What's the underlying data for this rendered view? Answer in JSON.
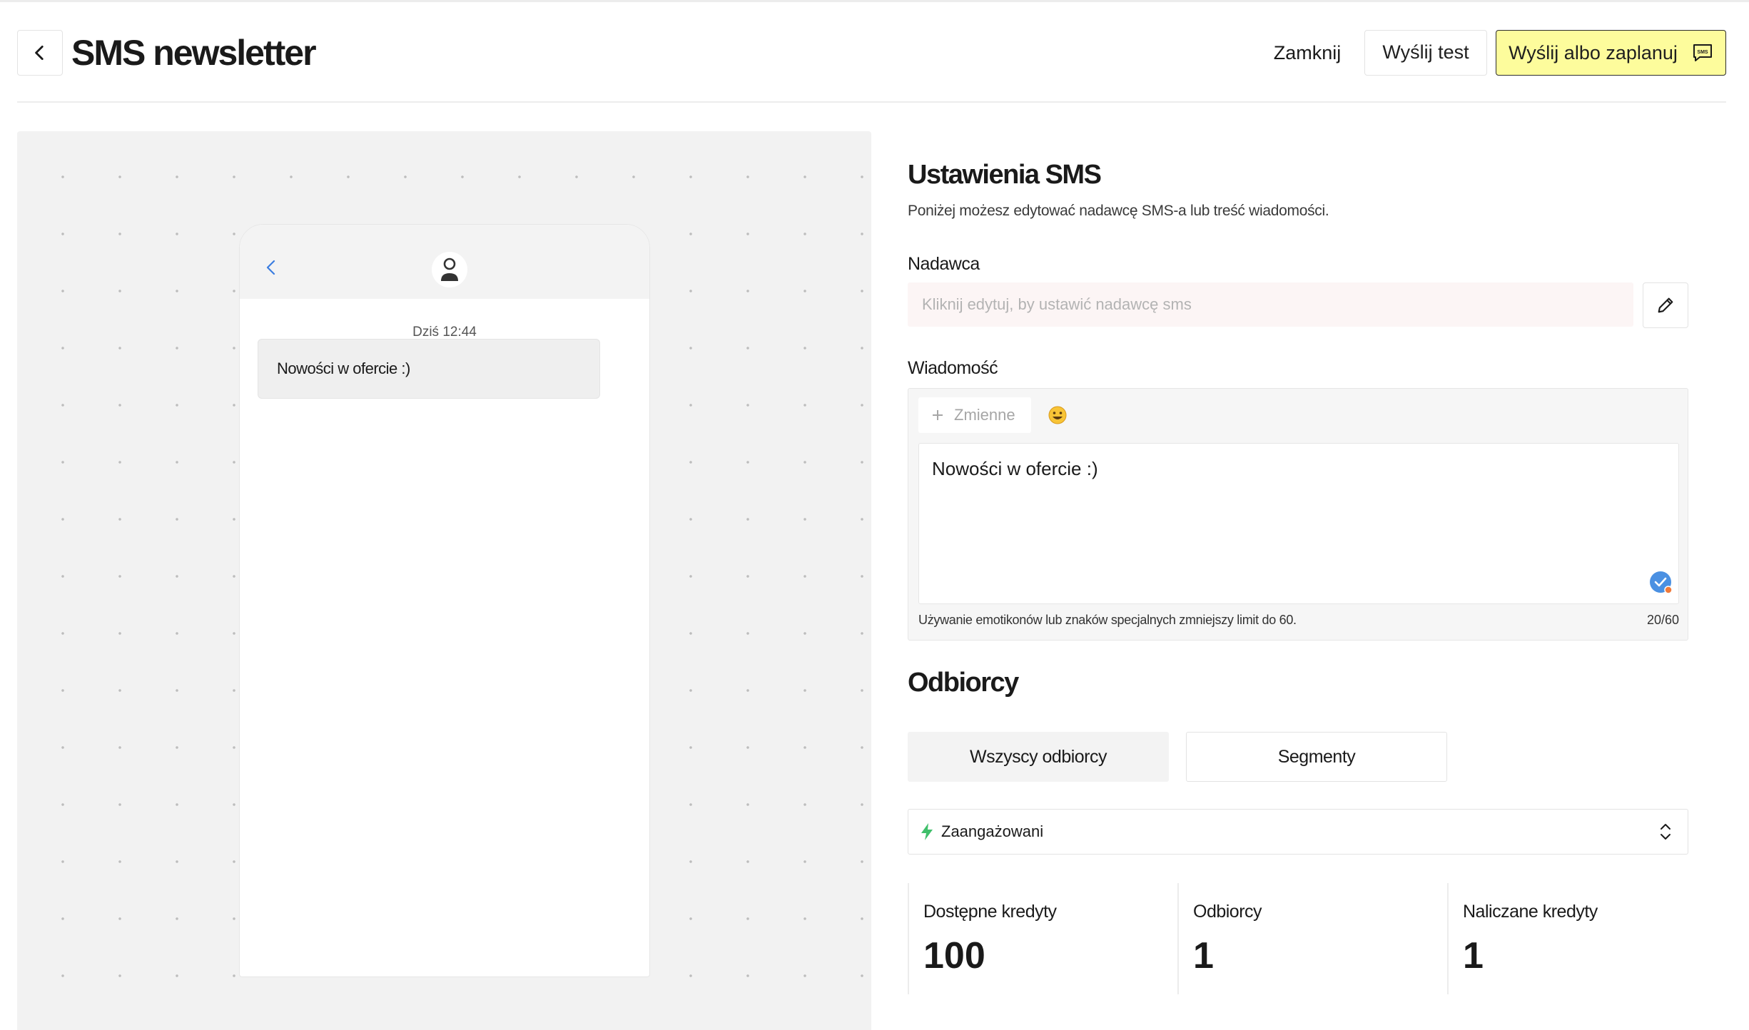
{
  "header": {
    "title": "SMS newsletter",
    "close_label": "Zamknij",
    "test_label": "Wyślij test",
    "send_label": "Wyślij albo zaplanuj",
    "send_icon": "sms-chat-icon",
    "accent_color": "#fdfc9c"
  },
  "preview": {
    "time": "Dziś 12:44",
    "bubble_text": "Nowości w ofercie :)"
  },
  "settings": {
    "title": "Ustawienia SMS",
    "description": "Poniżej możesz edytować nadawcę SMS-a lub treść wiadomości.",
    "sender_label": "Nadawca",
    "sender_placeholder": "Kliknij edytuj, by ustawić nadawcę sms",
    "message_label": "Wiadomość",
    "variables_label": "Zmienne",
    "emoji": "😀",
    "message_text": "Nowości w ofercie :)",
    "hint": "Używanie emotikonów lub znaków specjalnych zmniejszy limit do 60.",
    "char_count": "20/60"
  },
  "recipients": {
    "title": "Odbiorcy",
    "tab_all": "Wszyscy odbiorcy",
    "tab_segments": "Segmenty",
    "selected_segment": "Zaangażowani",
    "segment_icon_color": "#3fbf6a"
  },
  "stats": [
    {
      "label": "Dostępne kredyty",
      "value": "100"
    },
    {
      "label": "Odbiorcy",
      "value": "1"
    },
    {
      "label": "Naliczane kredyty",
      "value": "1"
    }
  ]
}
